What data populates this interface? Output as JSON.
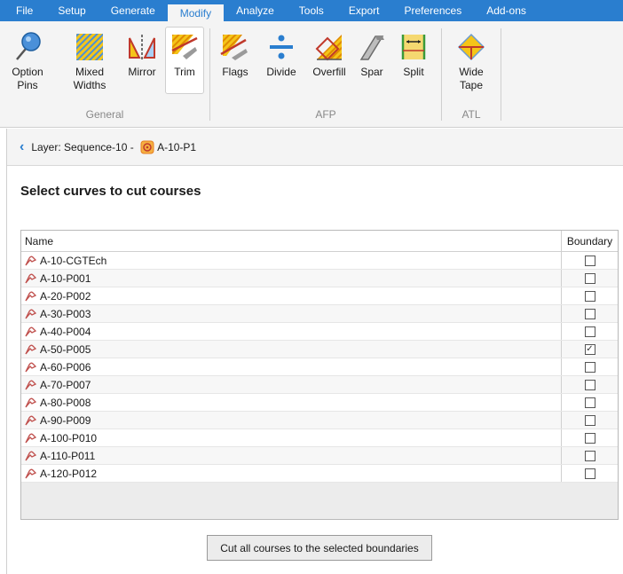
{
  "menu": {
    "items": [
      "File",
      "Setup",
      "Generate",
      "Modify",
      "Analyze",
      "Tools",
      "Export",
      "Preferences",
      "Add-ons"
    ],
    "active": "Modify"
  },
  "ribbon": {
    "general": {
      "label": "General",
      "tools": [
        {
          "line1": "Option",
          "line2": "Pins",
          "icon": "option-pins-icon"
        },
        {
          "line1": "Mixed",
          "line2": "Widths",
          "icon": "mixed-widths-icon"
        },
        {
          "line1": "Mirror",
          "line2": "",
          "icon": "mirror-icon"
        },
        {
          "line1": "Trim",
          "line2": "",
          "icon": "trim-icon"
        }
      ]
    },
    "afp": {
      "label": "AFP",
      "tools": [
        {
          "line1": "Flags",
          "icon": "flags-icon"
        },
        {
          "line1": "Divide",
          "icon": "divide-icon"
        },
        {
          "line1": "Overfill",
          "icon": "overfill-icon"
        },
        {
          "line1": "Spar",
          "icon": "spar-icon"
        },
        {
          "line1": "Split",
          "icon": "split-icon"
        }
      ]
    },
    "atl": {
      "label": "ATL",
      "tools": [
        {
          "line1": "Wide",
          "line2": "Tape",
          "icon": "wide-tape-icon"
        }
      ]
    }
  },
  "breadcrumb": {
    "prefix": "Layer: Sequence-10 - ",
    "item": "A-10-P1"
  },
  "heading": "Select curves to cut courses",
  "table": {
    "col_name": "Name",
    "col_boundary": "Boundary",
    "rows": [
      {
        "name": "A-10-CGTEch",
        "checked": false
      },
      {
        "name": "A-10-P001",
        "checked": false
      },
      {
        "name": "A-20-P002",
        "checked": false
      },
      {
        "name": "A-30-P003",
        "checked": false
      },
      {
        "name": "A-40-P004",
        "checked": false
      },
      {
        "name": "A-50-P005",
        "checked": true
      },
      {
        "name": "A-60-P006",
        "checked": false
      },
      {
        "name": "A-70-P007",
        "checked": false
      },
      {
        "name": "A-80-P008",
        "checked": false
      },
      {
        "name": "A-90-P009",
        "checked": false
      },
      {
        "name": "A-100-P010",
        "checked": false
      },
      {
        "name": "A-110-P011",
        "checked": false
      },
      {
        "name": "A-120-P012",
        "checked": false
      }
    ]
  },
  "cut_button": "Cut all courses to the selected boundaries",
  "colors": {
    "accent": "#2a7ecf",
    "ply_icon": "#c0504d",
    "hatch": "#f0c000"
  }
}
